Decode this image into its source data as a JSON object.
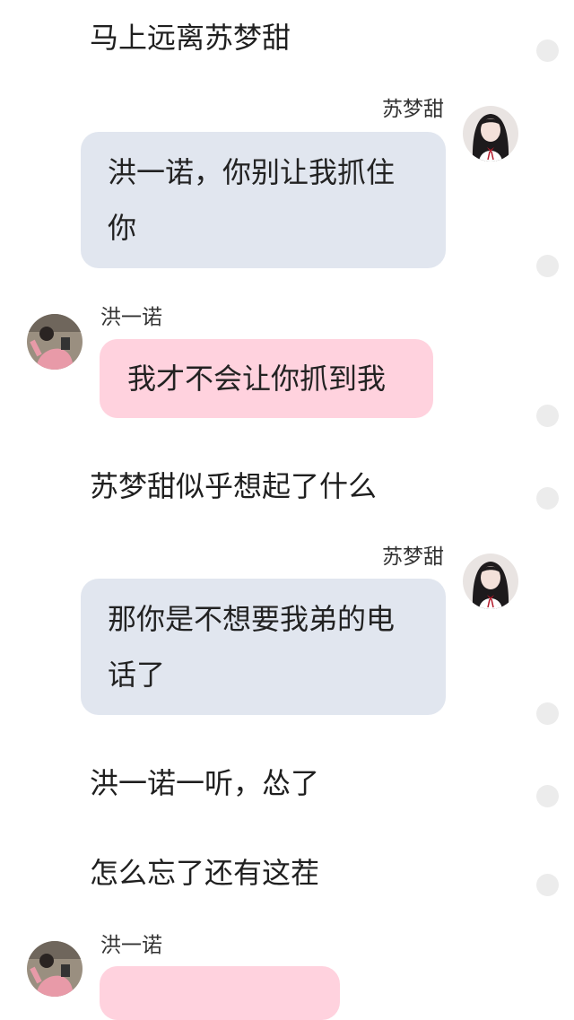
{
  "chat": {
    "narration_1": "马上远离苏梦甜",
    "msg_1": {
      "sender": "苏梦甜",
      "text": "洪一诺，你别让我抓住你"
    },
    "msg_2": {
      "sender": "洪一诺",
      "text": "我才不会让你抓到我"
    },
    "narration_2": "苏梦甜似乎想起了什么",
    "msg_3": {
      "sender": "苏梦甜",
      "text": "那你是不想要我弟的电话了"
    },
    "narration_3": "洪一诺一听，怂了",
    "narration_4": "怎么忘了还有这茬",
    "msg_4": {
      "sender": "洪一诺",
      "text": ""
    }
  },
  "colors": {
    "right_bubble": "#e1e6ef",
    "left_bubble": "#ffd2de",
    "side_dot": "#ececec"
  }
}
